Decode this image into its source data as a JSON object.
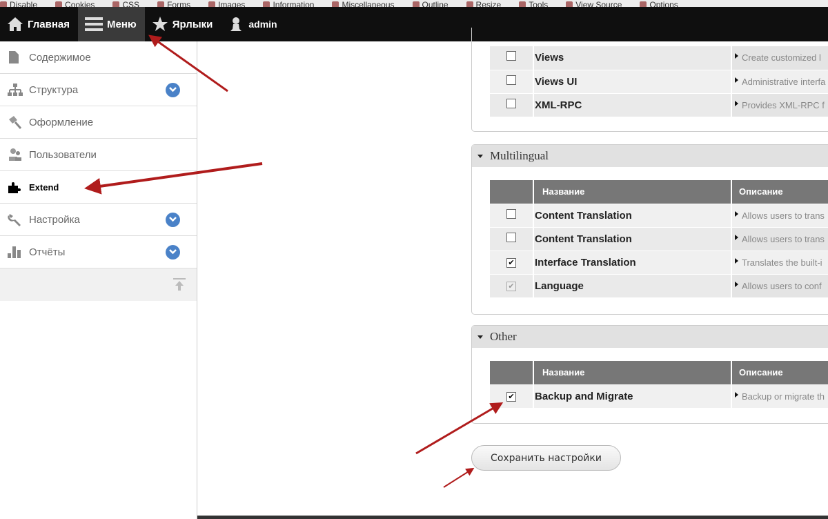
{
  "devbar": [
    "Disable",
    "Cookies",
    "CSS",
    "Forms",
    "Images",
    "Information",
    "Miscellaneous",
    "Outline",
    "Resize",
    "Tools",
    "View Source",
    "Options"
  ],
  "topbar": {
    "home": "Главная",
    "menu": "Меню",
    "shortcuts": "Ярлыки",
    "user": "admin"
  },
  "sidebar": {
    "items": [
      {
        "label": "Содержимое",
        "icon": "file-icon"
      },
      {
        "label": "Структура",
        "icon": "sitemap-icon",
        "expand": true
      },
      {
        "label": "Оформление",
        "icon": "paintbrush-icon"
      },
      {
        "label": "Пользователи",
        "icon": "users-icon"
      },
      {
        "label": "Extend",
        "icon": "puzzle-icon",
        "active": true
      },
      {
        "label": "Настройка",
        "icon": "wrench-icon",
        "expand": true
      },
      {
        "label": "Отчёты",
        "icon": "bar-chart-icon",
        "expand": true
      }
    ]
  },
  "columns": {
    "name": "Название",
    "description": "Описание"
  },
  "groups": {
    "top": {
      "rows": [
        {
          "name": "Views",
          "desc": "Create customized l",
          "checked": false
        },
        {
          "name": "Views UI",
          "desc": "Administrative interfa",
          "checked": false
        },
        {
          "name": "XML-RPC",
          "desc": "Provides XML-RPC f",
          "checked": false
        }
      ]
    },
    "multilingual": {
      "title": "Multilingual",
      "rows": [
        {
          "name": "Content Translation",
          "desc": "Allows users to trans",
          "checked": false
        },
        {
          "name": "Content Translation",
          "desc": "Allows users to trans",
          "checked": false
        },
        {
          "name": "Interface Translation",
          "desc": "Translates the built-i",
          "checked": true
        },
        {
          "name": "Language",
          "desc": "Allows users to conf",
          "checked": true,
          "disabled": true
        }
      ]
    },
    "other": {
      "title": "Other",
      "rows": [
        {
          "name": "Backup and Migrate",
          "desc": "Backup or migrate th",
          "checked": true
        }
      ]
    }
  },
  "save_button": "Сохранить настройки",
  "colors": {
    "toolbar": "#0f0f0f",
    "accent": "#4a82c8",
    "arrow": "#b01c1c"
  }
}
